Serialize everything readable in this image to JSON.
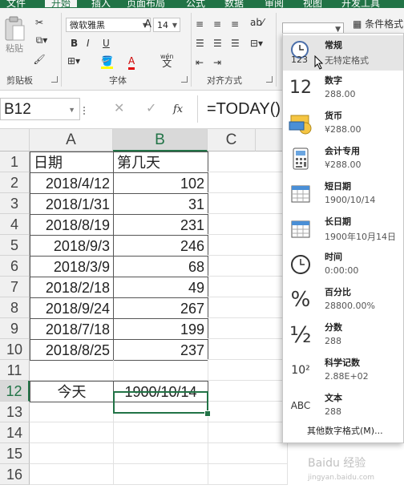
{
  "ribbon": {
    "tabs": [
      "文件",
      "开始",
      "插入",
      "页面布局",
      "公式",
      "数据",
      "审阅",
      "视图",
      "开发工具"
    ],
    "active_tab": "开始",
    "clipboard_label": "剪贴板",
    "paste_label": "粘贴",
    "font_label": "字体",
    "alignment_label": "对齐方式",
    "font_name": "微软雅黑",
    "font_size": "14",
    "bold": "B",
    "italic": "I",
    "underline": "U",
    "grow_font": "A",
    "shrink_font": "A",
    "font_color_letter": "A",
    "wen_label": "wén",
    "wen_char": "文",
    "conditional_format": "条件格式",
    "number_format_value": ""
  },
  "formula_bar": {
    "name_box": "B12",
    "formula": "=TODAY()",
    "fx": "fx"
  },
  "sheet": {
    "columns": [
      "A",
      "B",
      "C"
    ],
    "selected_column": "B",
    "rows": [
      {
        "num": "1",
        "a": "日期",
        "b": "第几天"
      },
      {
        "num": "2",
        "a": "2018/4/12",
        "b": "102"
      },
      {
        "num": "3",
        "a": "2018/1/31",
        "b": "31"
      },
      {
        "num": "4",
        "a": "2018/8/19",
        "b": "231"
      },
      {
        "num": "5",
        "a": "2018/9/3",
        "b": "246"
      },
      {
        "num": "6",
        "a": "2018/3/9",
        "b": "68"
      },
      {
        "num": "7",
        "a": "2018/2/18",
        "b": "49"
      },
      {
        "num": "8",
        "a": "2018/9/24",
        "b": "267"
      },
      {
        "num": "9",
        "a": "2018/7/18",
        "b": "199"
      },
      {
        "num": "10",
        "a": "2018/8/25",
        "b": "237"
      },
      {
        "num": "11",
        "a": "",
        "b": ""
      },
      {
        "num": "12",
        "a": "今天",
        "b": "1900/10/14"
      },
      {
        "num": "13",
        "a": "",
        "b": ""
      },
      {
        "num": "14",
        "a": "",
        "b": ""
      },
      {
        "num": "15",
        "a": "",
        "b": ""
      },
      {
        "num": "16",
        "a": "",
        "b": ""
      }
    ],
    "selected_row": "12"
  },
  "number_format_menu": {
    "items": [
      {
        "name": "常规",
        "example": "无特定格式",
        "icon": "clock-123-icon"
      },
      {
        "name": "数字",
        "example": "288.00",
        "icon": "number-12-icon",
        "glyph": "12"
      },
      {
        "name": "货币",
        "example": "¥288.00",
        "icon": "currency-icon"
      },
      {
        "name": "会计专用",
        "example": "¥288.00",
        "icon": "calculator-icon"
      },
      {
        "name": "短日期",
        "example": "1900/10/14",
        "icon": "calendar-short-icon"
      },
      {
        "name": "长日期",
        "example": "1900年10月14日",
        "icon": "calendar-long-icon"
      },
      {
        "name": "时间",
        "example": "0:00:00",
        "icon": "clock-icon"
      },
      {
        "name": "百分比",
        "example": "28800.00%",
        "icon": "percent-icon",
        "glyph": "%"
      },
      {
        "name": "分数",
        "example": "288",
        "icon": "fraction-icon",
        "glyph": "½"
      },
      {
        "name": "科学记数",
        "example": "2.88E+02",
        "icon": "scientific-icon",
        "glyph": "10²"
      },
      {
        "name": "文本",
        "example": "288",
        "icon": "text-abc-icon",
        "glyph": "ABC"
      }
    ],
    "more_label": "其他数字格式(M)...",
    "icon_123": "123"
  },
  "colors": {
    "excel_green": "#217346",
    "highlight": "#e5e5e5"
  },
  "watermark": {
    "line1": "Baidu 经验",
    "line2": "jingyan.baidu.com"
  }
}
